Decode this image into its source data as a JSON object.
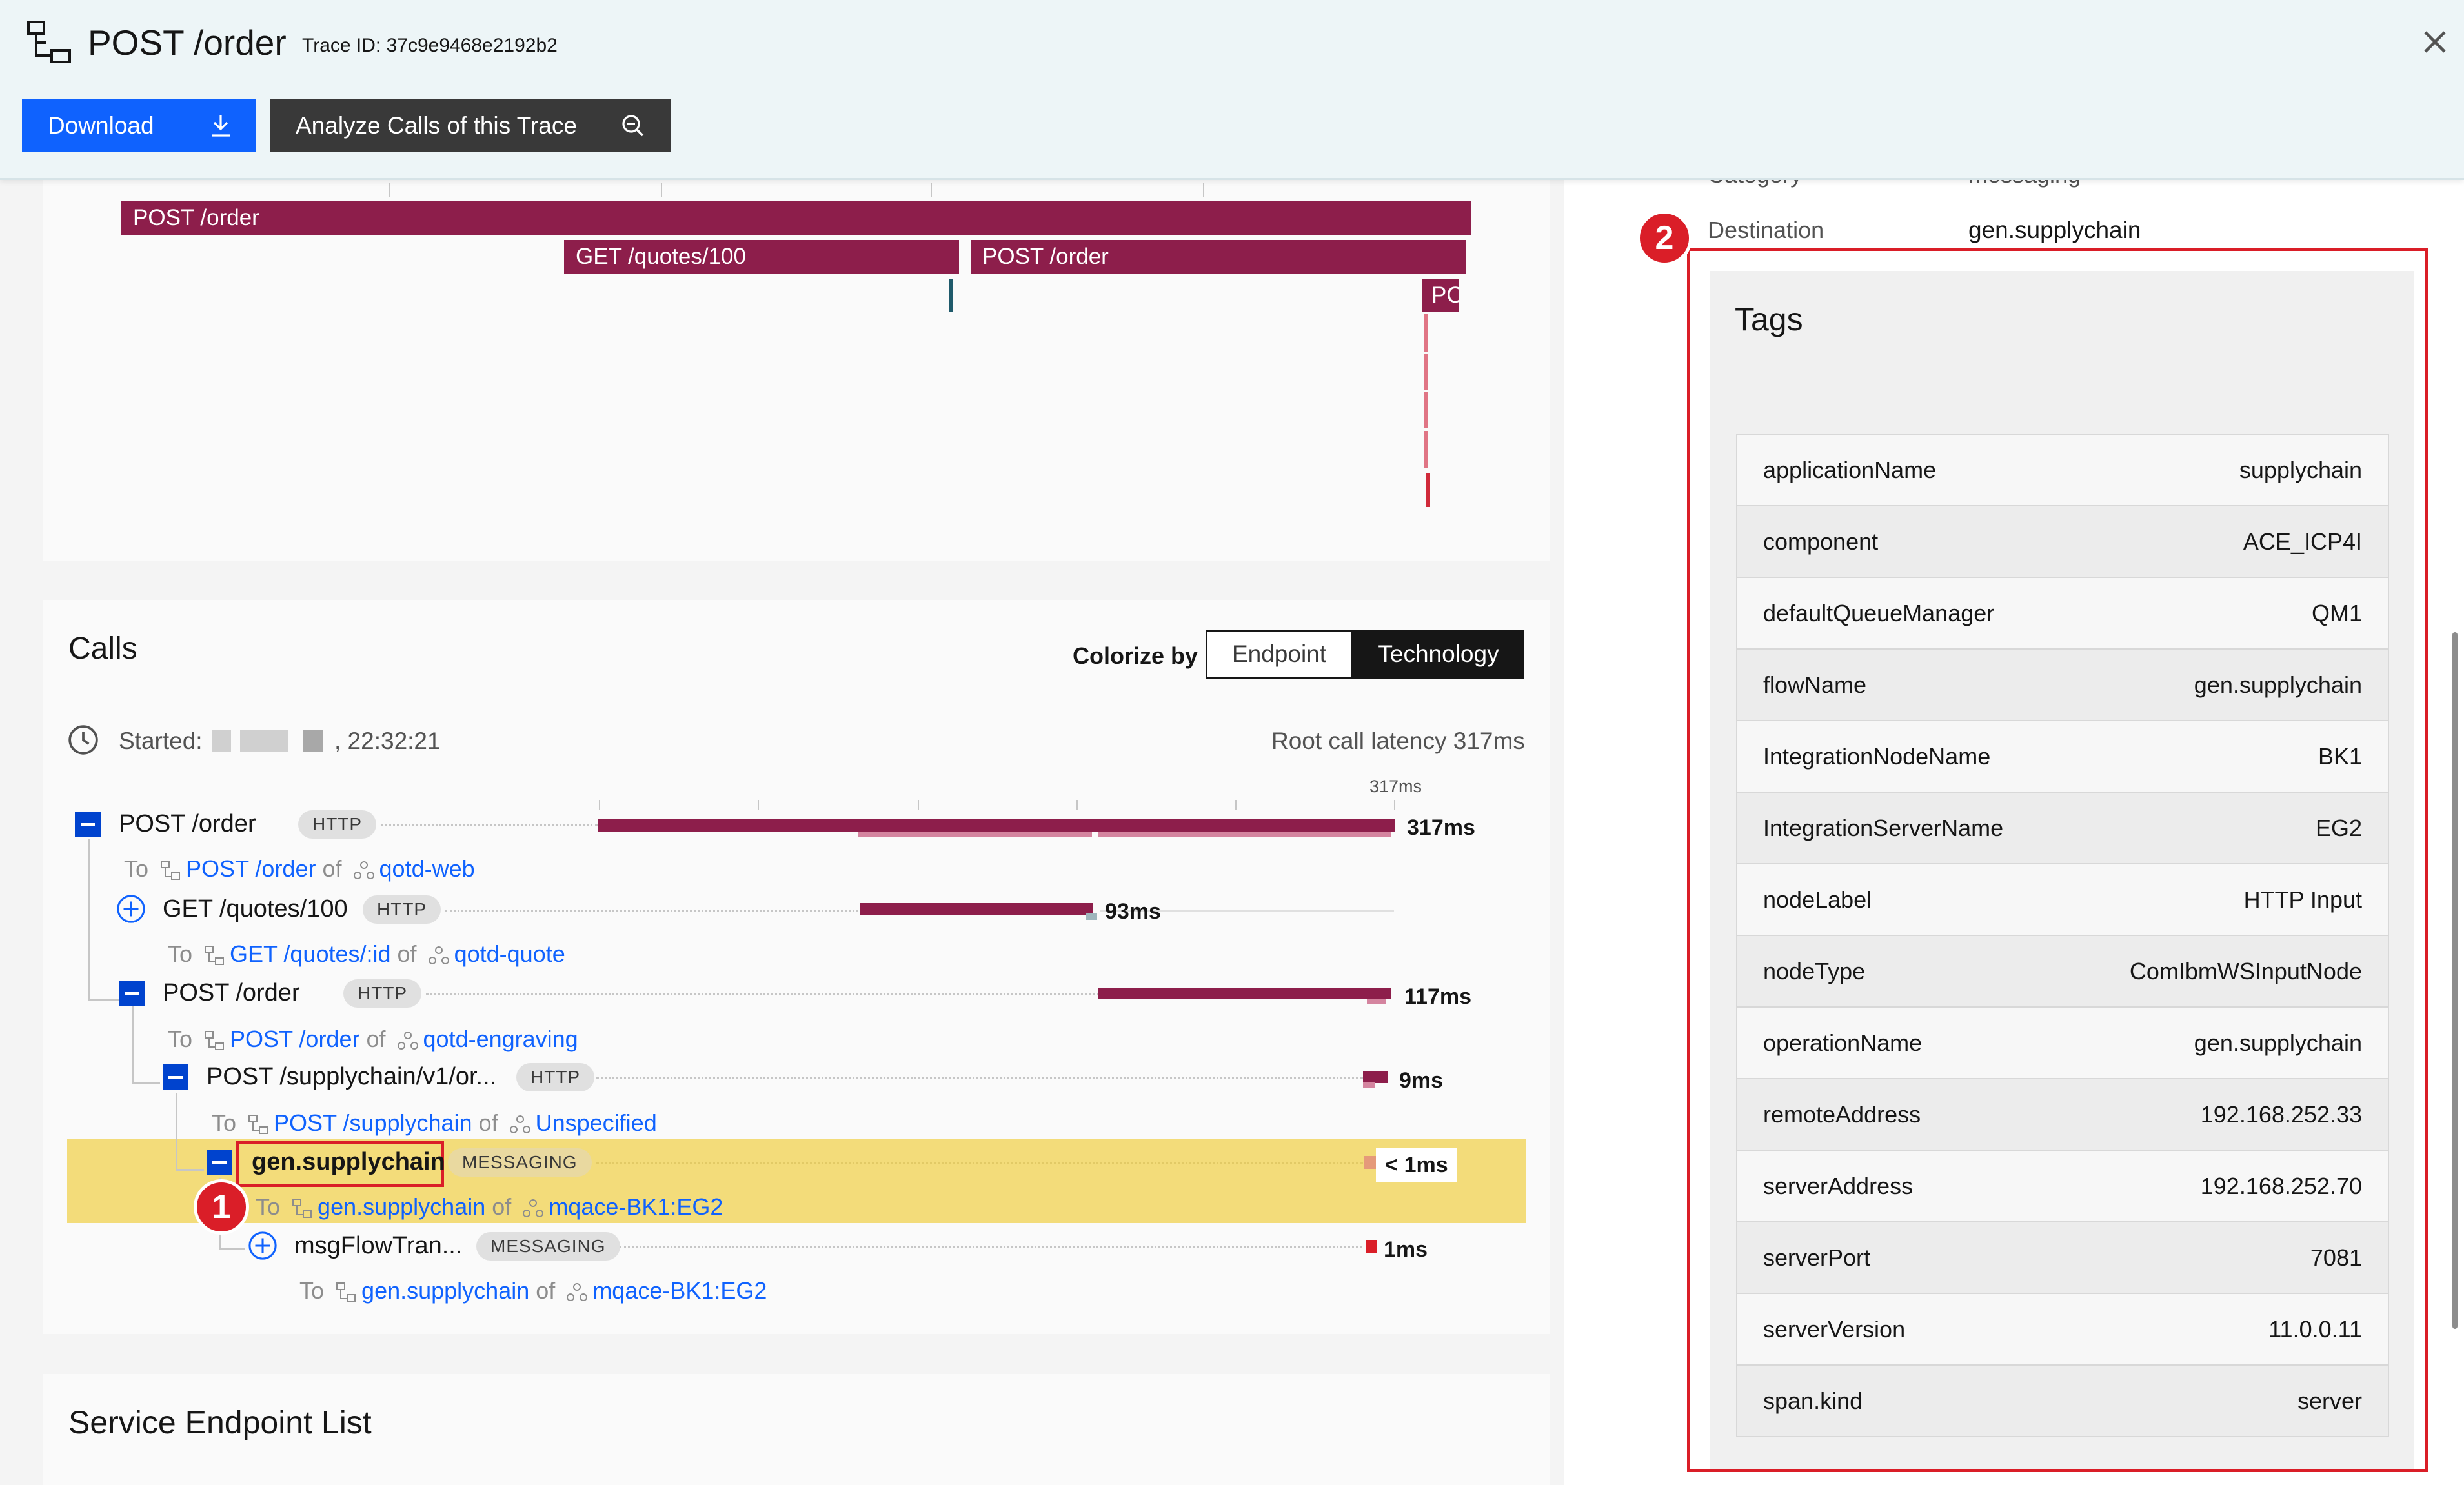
{
  "header": {
    "title": "POST /order",
    "trace_id": "Trace ID: 37c9e9468e2192b2",
    "download_label": "Download",
    "analyze_label": "Analyze Calls of this Trace"
  },
  "timeline": {
    "bars": [
      "POST /order",
      "GET /quotes/100",
      "POST /order",
      "PC"
    ]
  },
  "calls": {
    "title": "Calls",
    "colorize_label": "Colorize by",
    "toggle_endpoint": "Endpoint",
    "toggle_technology": "Technology",
    "started_label": "Started:",
    "started_time": ", 22:32:21",
    "root_latency": "Root call latency 317ms",
    "scale_label": "317ms",
    "rows": [
      {
        "name": "POST /order",
        "badge": "HTTP",
        "duration": "317ms",
        "to": "To",
        "endpoint": "POST /order",
        "of": "of",
        "service": "qotd-web"
      },
      {
        "name": "GET /quotes/100",
        "badge": "HTTP",
        "duration": "93ms",
        "to": "To",
        "endpoint": "GET /quotes/:id",
        "of": "of",
        "service": "qotd-quote"
      },
      {
        "name": "POST /order",
        "badge": "HTTP",
        "duration": "117ms",
        "to": "To",
        "endpoint": "POST /order",
        "of": "of",
        "service": "qotd-engraving"
      },
      {
        "name": "POST /supplychain/v1/or...",
        "badge": "HTTP",
        "duration": "9ms",
        "to": "To",
        "endpoint": "POST /supplychain",
        "of": "of",
        "service": "Unspecified"
      },
      {
        "name": "gen.supplychain",
        "badge": "MESSAGING",
        "duration": "< 1ms",
        "to": "To",
        "endpoint": "gen.supplychain",
        "of": "of",
        "service": "mqace-BK1:EG2"
      },
      {
        "name": "msgFlowTran...",
        "badge": "MESSAGING",
        "duration": "1ms",
        "to": "To",
        "endpoint": "gen.supplychain",
        "of": "of",
        "service": "mqace-BK1:EG2"
      }
    ]
  },
  "service_endpoint_list": {
    "title": "Service Endpoint List"
  },
  "details": {
    "category_label": "Category",
    "category_value": "messaging",
    "destination_label": "Destination",
    "destination_value": "gen.supplychain",
    "tags_title": "Tags",
    "tags": [
      {
        "key": "applicationName",
        "value": "supplychain"
      },
      {
        "key": "component",
        "value": "ACE_ICP4I"
      },
      {
        "key": "defaultQueueManager",
        "value": "QM1"
      },
      {
        "key": "flowName",
        "value": "gen.supplychain"
      },
      {
        "key": "IntegrationNodeName",
        "value": "BK1"
      },
      {
        "key": "IntegrationServerName",
        "value": "EG2"
      },
      {
        "key": "nodeLabel",
        "value": "HTTP Input"
      },
      {
        "key": "nodeType",
        "value": "ComIbmWSInputNode"
      },
      {
        "key": "operationName",
        "value": "gen.supplychain"
      },
      {
        "key": "remoteAddress",
        "value": "192.168.252.33"
      },
      {
        "key": "serverAddress",
        "value": "192.168.252.70"
      },
      {
        "key": "serverPort",
        "value": "7081"
      },
      {
        "key": "serverVersion",
        "value": "11.0.0.11"
      },
      {
        "key": "span.kind",
        "value": "server"
      }
    ]
  },
  "markers": [
    "1",
    "2"
  ],
  "colors": {
    "accent": "#0f62fe",
    "bar": "#8d1e4b",
    "highlight": "#f3dc7a",
    "marker": "#da1e28"
  }
}
